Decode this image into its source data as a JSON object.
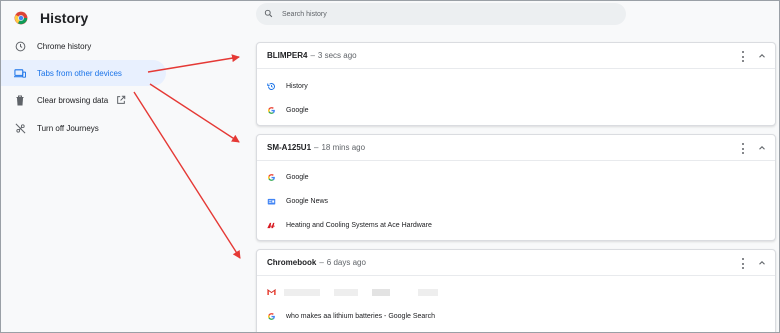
{
  "app": {
    "title": "History"
  },
  "sidebar": {
    "items": [
      {
        "label": "Chrome history",
        "icon": "clock-icon"
      },
      {
        "label": "Tabs from other devices",
        "icon": "devices-icon"
      },
      {
        "label": "Clear browsing data",
        "icon": "trash-icon"
      },
      {
        "label": "Turn off Journeys",
        "icon": "journeys-off-icon"
      }
    ]
  },
  "search": {
    "placeholder": "Search history"
  },
  "devices": [
    {
      "name": "BLIMPER4",
      "sep": "–",
      "time": "3 secs ago",
      "tabs": [
        {
          "title": "History",
          "icon": "history-icon"
        },
        {
          "title": "Google",
          "icon": "google-icon"
        }
      ]
    },
    {
      "name": "SM-A125U1",
      "sep": "–",
      "time": "18 mins ago",
      "tabs": [
        {
          "title": "Google",
          "icon": "google-icon"
        },
        {
          "title": "Google News",
          "icon": "google-news-icon"
        },
        {
          "title": "Heating and Cooling Systems at Ace Hardware",
          "icon": "ace-hardware-icon"
        }
      ]
    },
    {
      "name": "Chromebook",
      "sep": "–",
      "time": "6 days ago",
      "tabs": [
        {
          "title": "",
          "icon": "gmail-icon"
        },
        {
          "title": "who makes aa lithium batteries - Google Search",
          "icon": "google-icon"
        }
      ]
    }
  ],
  "colors": {
    "accent": "#1a73e8",
    "active_bg": "#e8f0fe",
    "arrow": "#e53935"
  }
}
